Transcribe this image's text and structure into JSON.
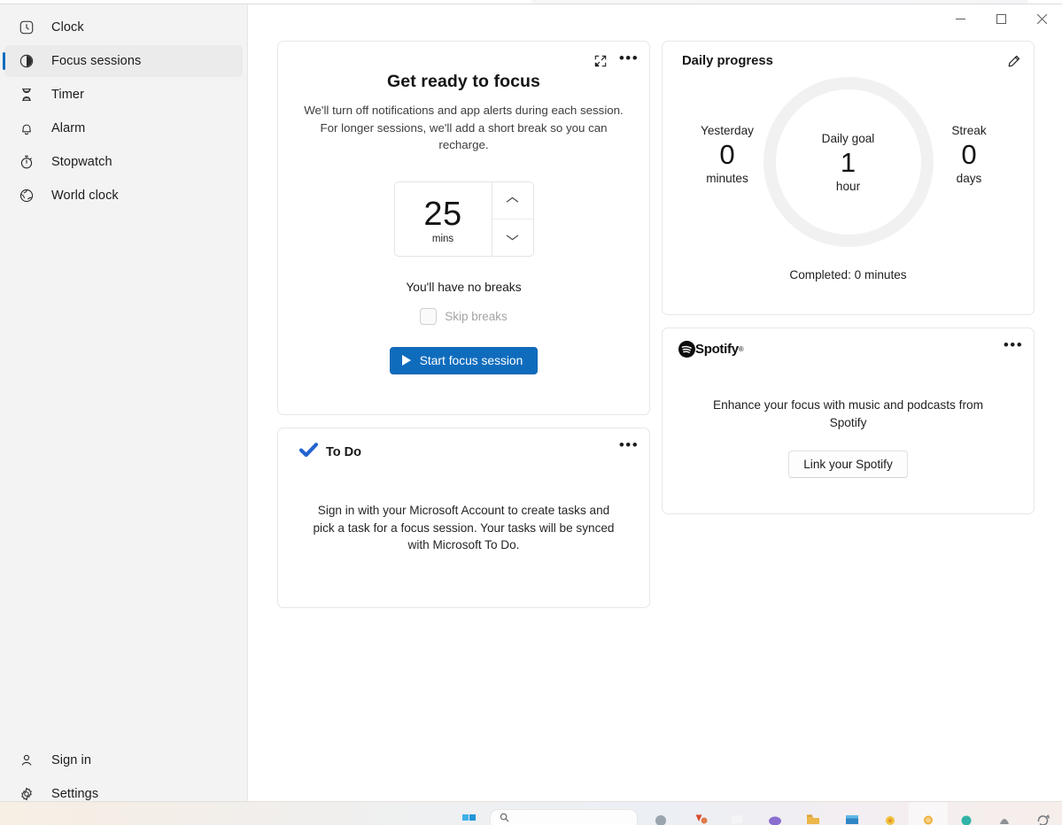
{
  "window": {
    "controls": {
      "minimize": "Minimize",
      "maximize": "Maximize",
      "close": "Close"
    }
  },
  "sidebar": {
    "items": [
      {
        "label": "Clock",
        "icon": "clock-icon",
        "selected": false
      },
      {
        "label": "Focus sessions",
        "icon": "focus-icon",
        "selected": true
      },
      {
        "label": "Timer",
        "icon": "hourglass-icon",
        "selected": false
      },
      {
        "label": "Alarm",
        "icon": "bell-icon",
        "selected": false
      },
      {
        "label": "Stopwatch",
        "icon": "stopwatch-icon",
        "selected": false
      },
      {
        "label": "World clock",
        "icon": "globe-icon",
        "selected": false
      }
    ],
    "bottom": [
      {
        "label": "Sign in",
        "icon": "person-icon"
      },
      {
        "label": "Settings",
        "icon": "gear-icon"
      }
    ]
  },
  "focus_card": {
    "title": "Get ready to focus",
    "description": "We'll turn off notifications and app alerts during each session. For longer sessions, we'll add a short break so you can recharge.",
    "duration_value": "25",
    "duration_unit": "mins",
    "increase_icon": "chevron-up-icon",
    "decrease_icon": "chevron-down-icon",
    "breaks_text": "You'll have no breaks",
    "skip_breaks_label": "Skip breaks",
    "skip_breaks_checked": false,
    "skip_breaks_enabled": false,
    "start_button": "Start focus session",
    "compact_overlay_icon": "compact-overlay-icon",
    "more_icon": "more-options-icon"
  },
  "todo_card": {
    "title": "To Do",
    "logo_icon": "to-do-check-icon",
    "body": "Sign in with your Microsoft Account to create tasks and pick a task for a focus session. Your tasks will be synced with Microsoft To Do.",
    "more_icon": "more-options-icon"
  },
  "daily_progress": {
    "title": "Daily progress",
    "edit_icon": "pencil-edit-icon",
    "center": {
      "label": "Daily goal",
      "value": "1",
      "unit": "hour"
    },
    "left": {
      "label": "Yesterday",
      "value": "0",
      "unit": "minutes"
    },
    "right": {
      "label": "Streak",
      "value": "0",
      "unit": "days"
    },
    "completed": "Completed: 0 minutes",
    "ring_percent": 0,
    "ring_track_color": "#f1f1f1"
  },
  "spotify_card": {
    "brand": "Spotify",
    "brand_mark": "®",
    "logo_icon": "spotify-logo-icon",
    "description": "Enhance your focus with music and podcasts from Spotify",
    "link_button": "Link your Spotify",
    "more_icon": "more-options-icon"
  },
  "taskbar": {
    "items": [
      {
        "icon": "windows-start-icon"
      },
      {
        "icon": "taskbar-search-box"
      },
      {
        "icon": "edge-icon"
      },
      {
        "icon": "vlc-icon"
      },
      {
        "icon": "explorer-window-icon"
      },
      {
        "icon": "onedrive-icon"
      },
      {
        "icon": "file-explorer-icon"
      },
      {
        "icon": "store-icon"
      },
      {
        "icon": "settings-app-icon"
      },
      {
        "icon": "clock-app-icon"
      },
      {
        "icon": "teams-icon"
      },
      {
        "icon": "xbox-icon"
      },
      {
        "icon": "sync-icon"
      }
    ]
  },
  "colors": {
    "accent": "#0f6cbd",
    "sidebar_bg": "#f3f3f3",
    "selected_bg": "#ebebeb",
    "todo_blue": "#2564cf",
    "spotify_black": "#0d0d0d"
  }
}
